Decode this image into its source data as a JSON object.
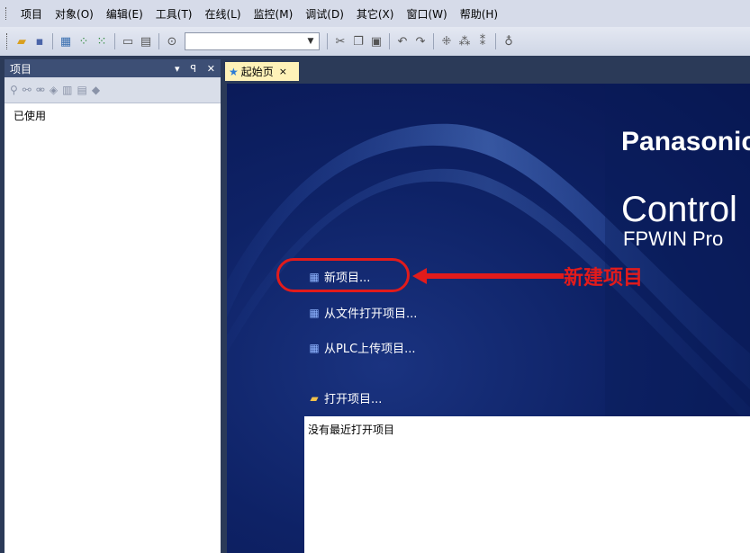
{
  "menu": {
    "items": [
      "项目",
      "对象(O)",
      "编辑(E)",
      "工具(T)",
      "在线(L)",
      "监控(M)",
      "调试(D)",
      "其它(X)",
      "窗口(W)",
      "帮助(H)"
    ]
  },
  "toolbar": {
    "combo_value": ""
  },
  "project_panel": {
    "title": "项目",
    "pin_glyph": "▾ ⊥ ×",
    "tree_item": "已使用"
  },
  "tabs": {
    "start": {
      "label": "起始页",
      "close": "×"
    }
  },
  "start_page": {
    "brand": "Panasonic",
    "product": "Control",
    "product_sub": "FPWIN Pro",
    "links": {
      "new_project": "新项目...",
      "open_from_file": "从文件打开项目...",
      "upload_from_plc": "从PLC上传项目...",
      "open_project": "打开项目..."
    },
    "annotation": "新建项目",
    "recent_empty": "没有最近打开项目"
  },
  "colors": {
    "accent_red": "#e21b1b",
    "panel_title": "#3d4f75",
    "tab_active": "#fff2b8",
    "start_bg": "#0e2266"
  }
}
